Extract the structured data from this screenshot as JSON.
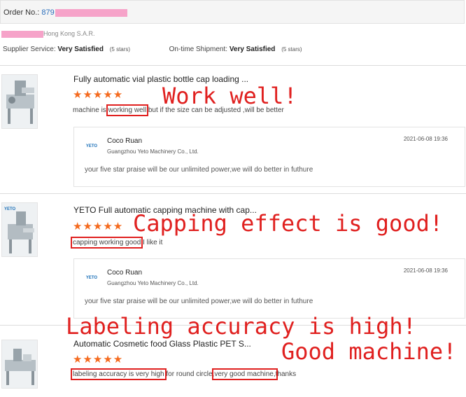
{
  "order": {
    "label": "Order No.:",
    "number": "879"
  },
  "supplier": {
    "location": "Hong Kong S.A.R.",
    "service_label": "Supplier Service:",
    "service_value": "Very Satisfied",
    "service_stars": "(5 stars)",
    "shipment_label": "On-time Shipment:",
    "shipment_value": "Very Satisfied",
    "shipment_stars": "(5 stars)"
  },
  "colors": {
    "accent": "#f56a1e",
    "highlight": "#e0201f",
    "redaction": "#f6a3c9",
    "link": "#2a6ebb"
  },
  "items": [
    {
      "title": "Fully automatic vial plastic bottle cap loading ...",
      "stars": "★★★★★",
      "review_pre": "machine is ",
      "review_hl1": "working well",
      "review_post": ",but if the size can be adjusted ,will be better",
      "reply": {
        "name": "Coco Ruan",
        "company": "Guangzhou Yeto Machinery Co., Ltd.",
        "date": "2021-06-08 19:36",
        "text": "your five star praise will be our unlimited power,we will do better in futhure"
      }
    },
    {
      "title": "YETO Full automatic capping machine with cap...",
      "stars": "★★★★★",
      "review_hl1": "capping working good",
      "review_post": ",I like it",
      "reply": {
        "name": "Coco Ruan",
        "company": "Guangzhou Yeto Machinery Co., Ltd.",
        "date": "2021-06-08 19:36",
        "text": "your five star praise will be our unlimited power,we will do better in futhure"
      }
    },
    {
      "title": "Automatic Cosmetic food Glass Plastic PET S...",
      "stars": "★★★★★",
      "review_hl1": "labeling accuracy is very high",
      "review_mid": " for round circle,",
      "review_hl2": "very good machine,",
      "review_post": "thanks"
    }
  ],
  "logo_text": "YETO",
  "annotations": {
    "a1": "Work well!",
    "a2": "Capping effect is good!",
    "a3": "Labeling accuracy is high!",
    "a4": "Good machine!"
  }
}
